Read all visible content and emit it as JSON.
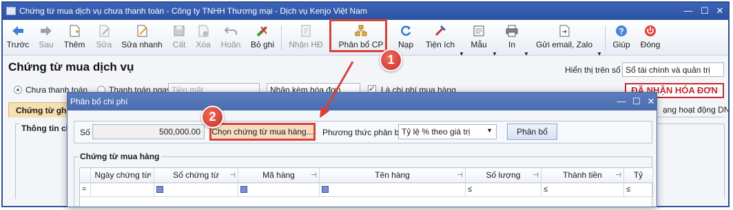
{
  "window": {
    "title": "Chứng từ mua dịch vụ chưa thanh toán - Công ty TNHH Thương mại - Dịch vụ Kenjo Việt Nam"
  },
  "toolbar": {
    "back": "Trước",
    "next": "Sau",
    "add": "Thêm",
    "edit": "Sửa",
    "quick_edit": "Sửa nhanh",
    "save": "Cất",
    "delete": "Xóa",
    "undo": "Hoãn",
    "unpost": "Bỏ ghi",
    "receive_invoice": "Nhận HĐ",
    "allocate_cost": "Phân bổ CP",
    "reload": "Nạp",
    "utilities": "Tiện ích",
    "template": "Mẫu",
    "print": "In",
    "send": "Gửi email, Zalo",
    "help": "Giúp",
    "close": "Đóng"
  },
  "form": {
    "heading": "Chứng từ mua dịch vụ",
    "display_label": "Hiển thị trên sổ",
    "display_value": "Sổ tài chính và quản trị",
    "unpaid_label": "Chưa thanh toán",
    "paid_label": "Thanh toán ngay",
    "payment_method_placeholder": "Tiền mặt",
    "invoice_field": "Nhận kèm hóa đơn",
    "purchase_cost_label": "Là chi phí mua hàng",
    "received_badge": "ĐÃ NHẬN HÓA ĐƠN",
    "tab_vouchers": "Chứng từ ghi",
    "tab_business": "ạng hoạt động DN",
    "general_info": "Thông tin chu"
  },
  "dialog": {
    "title": "Phân bổ chi phí",
    "amount_label": "Số tiền",
    "amount_value": "500,000.00",
    "choose_button": "Chọn chứng từ mua hàng...",
    "method_label": "Phương thức phân bổ",
    "method_value": "Tỷ lệ % theo giá trị",
    "allocate_button": "Phân bổ",
    "grid_title": "Chứng từ mua hàng",
    "columns": [
      "Ngày chứng từ",
      "Số chứng từ",
      "Mã hàng",
      "Tên hàng",
      "Số lượng",
      "Thành tiền",
      "Tỷ"
    ],
    "filters": [
      "=",
      "",
      "",
      "",
      "≤",
      "≤",
      "≤"
    ]
  },
  "annotations": {
    "step1": "1",
    "step2": "2"
  },
  "colors": {
    "title_bar": "#2c52a3",
    "highlight": "#d8403a",
    "badge": "#c0282d",
    "active_tab": "#f6dfb0"
  }
}
